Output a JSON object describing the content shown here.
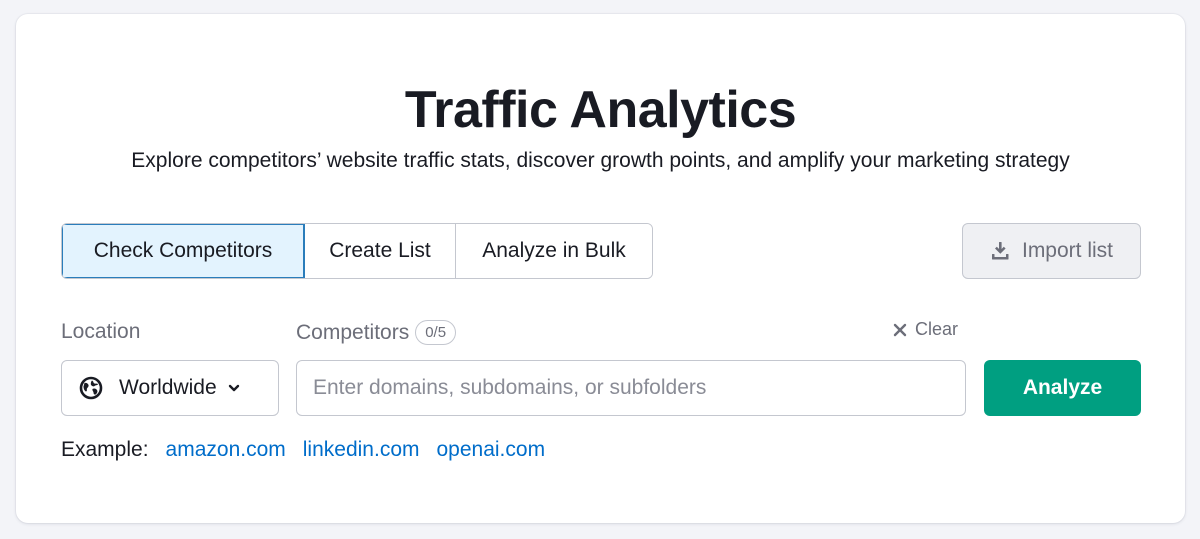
{
  "header": {
    "title": "Traffic Analytics",
    "subtitle": "Explore competitors’ website traffic stats, discover growth points, and amplify your marketing strategy"
  },
  "tabs": [
    {
      "label": "Check Competitors",
      "active": true
    },
    {
      "label": "Create List",
      "active": false
    },
    {
      "label": "Analyze in Bulk",
      "active": false
    }
  ],
  "import_button": {
    "label": "Import list",
    "icon": "download-icon"
  },
  "location": {
    "label": "Location",
    "selected": "Worldwide",
    "icon": "globe-icon"
  },
  "competitors": {
    "label": "Competitors",
    "count": "0/5",
    "placeholder": "Enter domains, subdomains, or subfolders",
    "value": ""
  },
  "clear_button": {
    "label": "Clear",
    "icon": "close-icon"
  },
  "analyze_button": {
    "label": "Analyze"
  },
  "examples": {
    "label": "Example:",
    "links": [
      "amazon.com",
      "linkedin.com",
      "openai.com"
    ]
  },
  "colors": {
    "accent_green": "#009f81",
    "link_blue": "#006dca",
    "active_tab_bg": "#e3f3fe",
    "active_tab_border": "#2a7dbb",
    "page_bg": "#f3f4f8"
  }
}
